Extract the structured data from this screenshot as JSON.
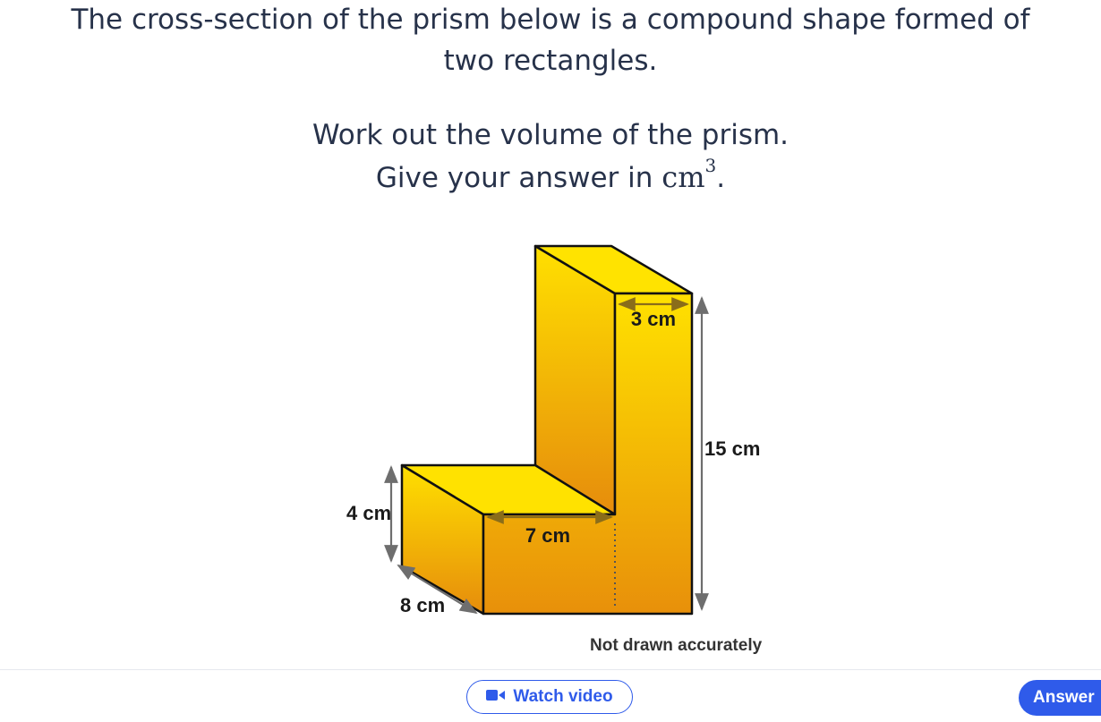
{
  "question": {
    "line1": "The cross-section of the prism below is a compound shape formed of",
    "line2": "two rectangles.",
    "line3": "Work out the volume of the prism.",
    "line4_text": "Give your answer in ",
    "unit_base": "cm",
    "unit_exp": "3",
    "line4_end": "."
  },
  "figure": {
    "labels": {
      "width_top": "3 cm",
      "height_total": "15 cm",
      "height_step": "4 cm",
      "step_length": "7 cm",
      "depth": "8 cm"
    },
    "note": "Not drawn accurately",
    "colors": {
      "fill_light": "#ffe100",
      "fill_dark": "#e8900a",
      "outline": "#111111",
      "arrow": "#6e6e6e"
    }
  },
  "actions": {
    "watch_video": "Watch video",
    "watch_icon": "video-camera-icon",
    "answer": "Answer"
  }
}
